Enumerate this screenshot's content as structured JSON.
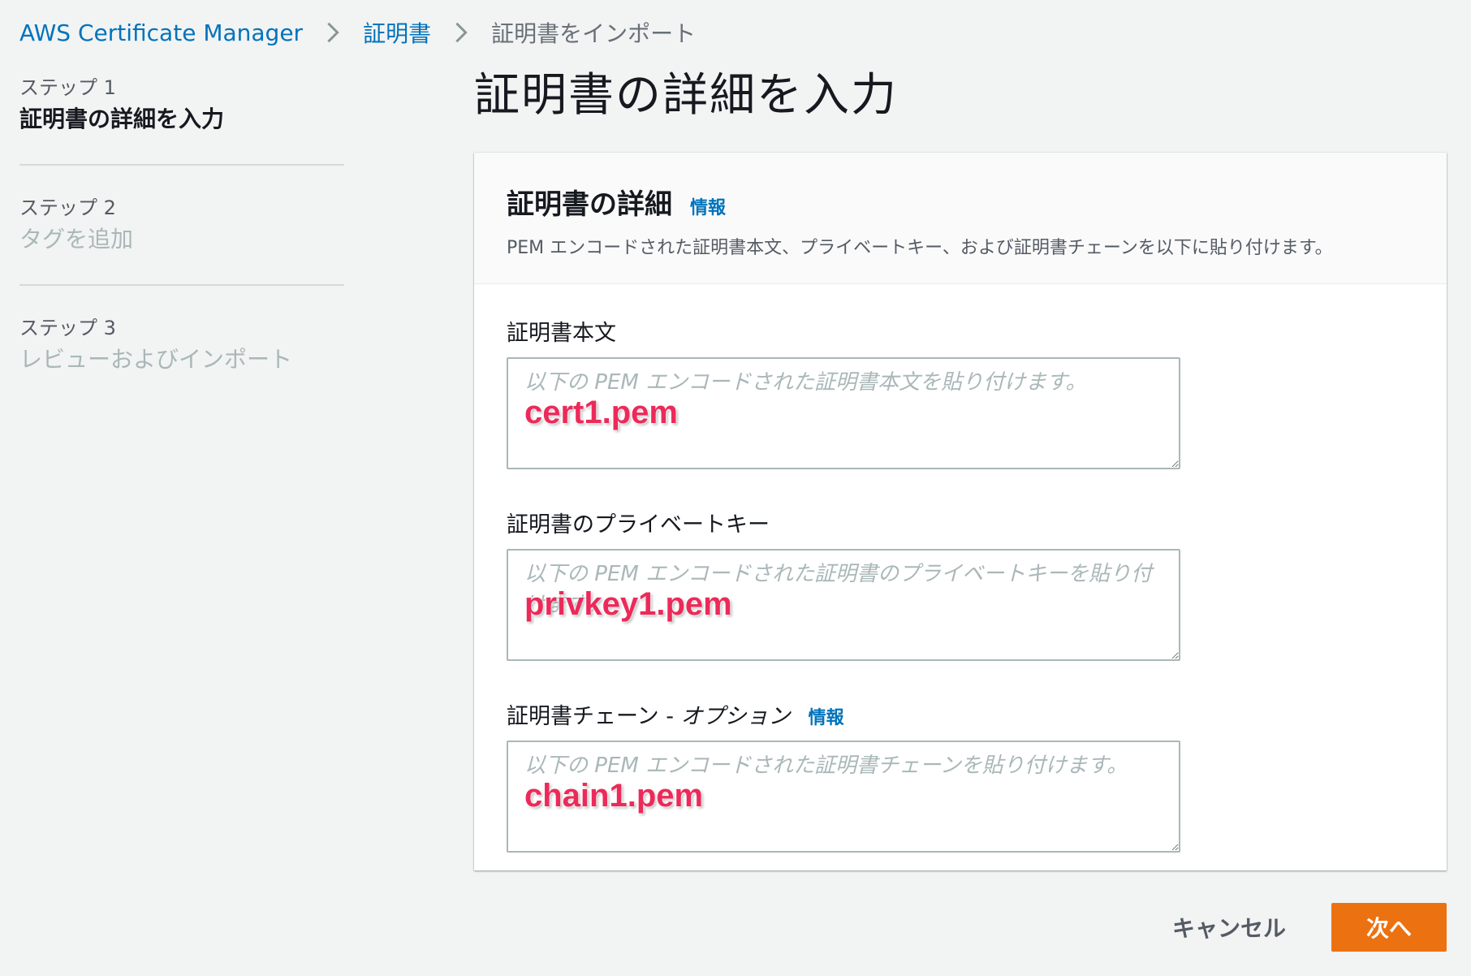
{
  "breadcrumb": {
    "service": "AWS Certificate Manager",
    "certificates": "証明書",
    "current": "証明書をインポート"
  },
  "steps": [
    {
      "num": "ステップ 1",
      "title": "証明書の詳細を入力"
    },
    {
      "num": "ステップ 2",
      "title": "タグを追加"
    },
    {
      "num": "ステップ 3",
      "title": "レビューおよびインポート"
    }
  ],
  "page_title": "証明書の詳細を入力",
  "container": {
    "title": "証明書の詳細",
    "info": "情報",
    "description": "PEM エンコードされた証明書本文、プライベートキー、および証明書チェーンを以下に貼り付けます。"
  },
  "fields": {
    "body": {
      "label": "証明書本文",
      "placeholder": "以下の PEM エンコードされた証明書本文を貼り付けます。",
      "annotation": "cert1.pem"
    },
    "private_key": {
      "label": "証明書のプライベートキー",
      "placeholder": "以下の PEM エンコードされた証明書のプライベートキーを貼り付けます。",
      "annotation": "privkey1.pem"
    },
    "chain": {
      "label": "証明書チェーン - ",
      "label_optional": "オプション",
      "info": "情報",
      "placeholder": "以下の PEM エンコードされた証明書チェーンを貼り付けます。",
      "annotation": "chain1.pem"
    }
  },
  "actions": {
    "cancel": "キャンセル",
    "next": "次へ"
  },
  "colors": {
    "link": "#0073bb",
    "primary": "#ec7211",
    "annotation": "#ec2a5a",
    "background": "#f2f3f3"
  }
}
